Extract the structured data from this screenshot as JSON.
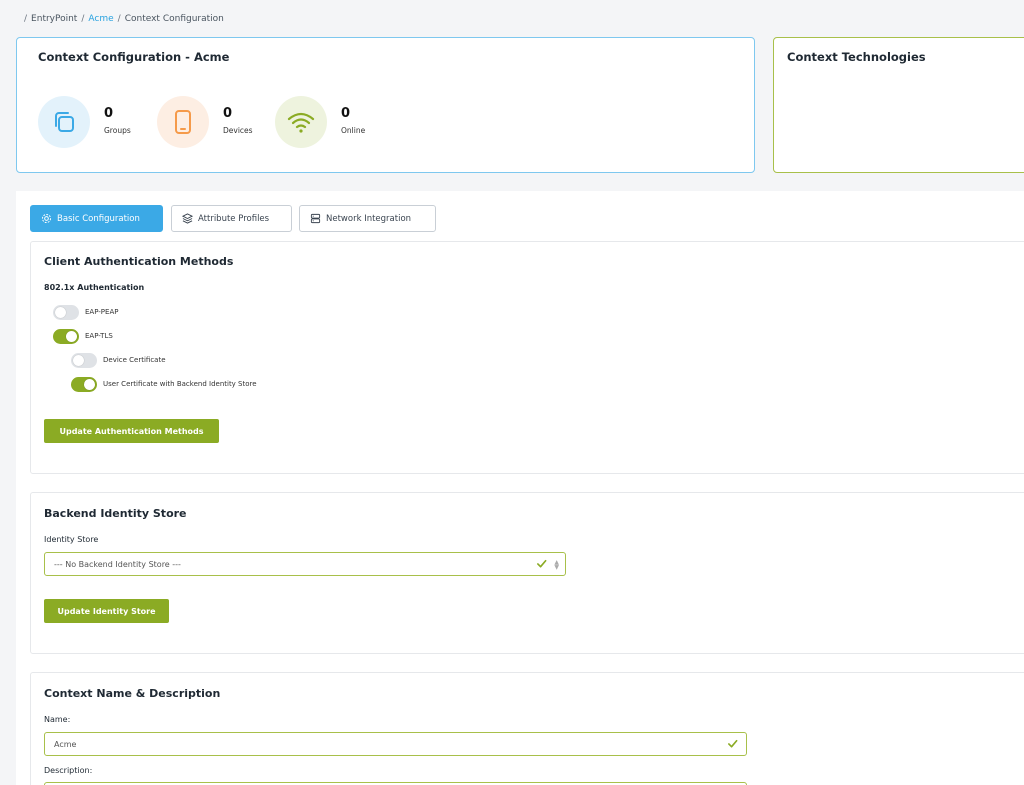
{
  "breadcrumb": {
    "items": [
      "EntryPoint",
      "Acme",
      "Context Configuration"
    ]
  },
  "context_card": {
    "title": "Context Configuration - Acme",
    "stats": [
      {
        "value": "0",
        "label": "Groups",
        "icon": "copy-icon"
      },
      {
        "value": "0",
        "label": "Devices",
        "icon": "tablet-icon"
      },
      {
        "value": "0",
        "label": "Online",
        "icon": "wifi-icon"
      }
    ]
  },
  "tech_card": {
    "title": "Context Technologies"
  },
  "tabs": [
    {
      "label": "Basic Configuration",
      "icon": "gear-icon",
      "active": true
    },
    {
      "label": "Attribute Profiles",
      "icon": "layers-icon",
      "active": false
    },
    {
      "label": "Network Integration",
      "icon": "server-icon",
      "active": false
    }
  ],
  "auth_section": {
    "title": "Client Authentication Methods",
    "subtitle": "802.1x Authentication",
    "toggles": [
      {
        "label": "EAP-PEAP",
        "on": false
      },
      {
        "label": "EAP-TLS",
        "on": true
      },
      {
        "label": "Device Certificate",
        "on": false
      },
      {
        "label": "User Certificate with Backend Identity Store",
        "on": true
      }
    ],
    "button": "Update Authentication Methods"
  },
  "identity_section": {
    "title": "Backend Identity Store",
    "field_label": "Identity Store",
    "selected": "--- No Backend Identity Store ---",
    "button": "Update Identity Store"
  },
  "name_section": {
    "title": "Context Name & Description",
    "name_label": "Name:",
    "name_value": "Acme",
    "description_label": "Description:"
  },
  "colors": {
    "accent_blue": "#3ba9e6",
    "accent_green": "#8bab24",
    "orange": "#f59a4a"
  }
}
